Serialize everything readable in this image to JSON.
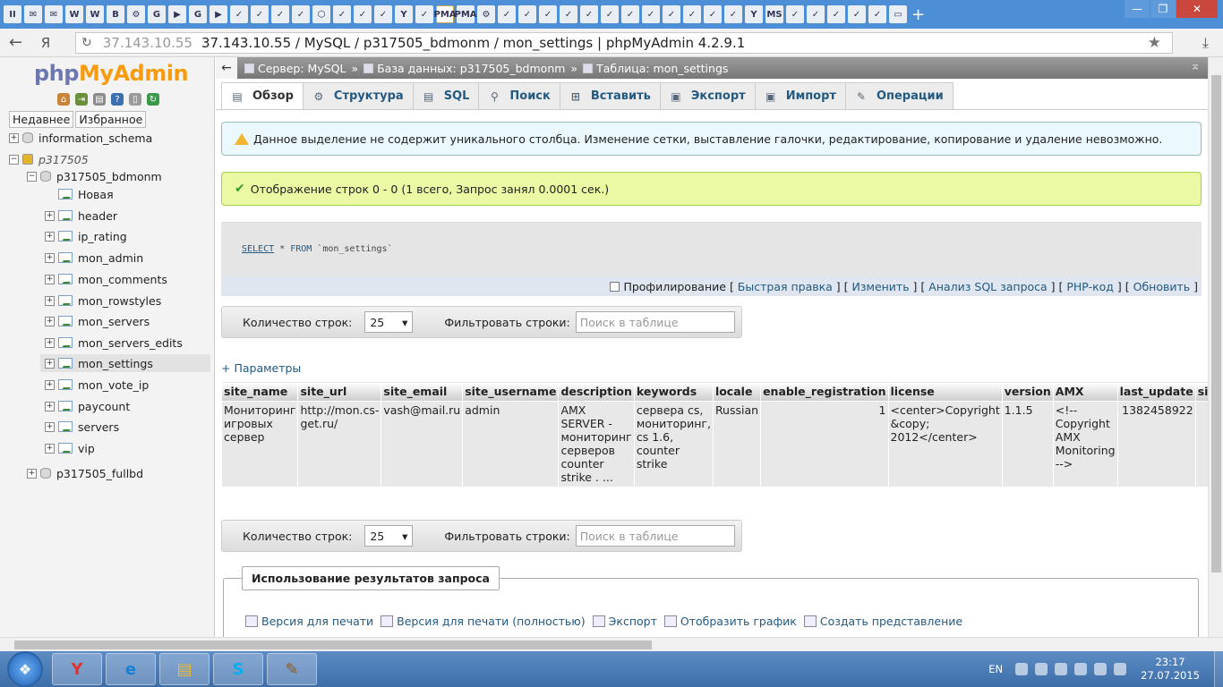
{
  "browser": {
    "tab_icons": [
      "II",
      "✉",
      "✉",
      "W",
      "W",
      "B",
      "⚙",
      "G",
      "▶",
      "G",
      "▶",
      "✓",
      "✓",
      "✓",
      "✓",
      "⬡",
      "✓",
      "✓",
      "✓",
      "Y",
      "✓",
      "PMA",
      "PMA",
      "⚙",
      "✓",
      "✓",
      "✓",
      "✓",
      "✓",
      "✓",
      "✓",
      "✓",
      "✓",
      "✓",
      "✓",
      "✓",
      "Y",
      "MS",
      "✓",
      "✓",
      "✓",
      "✓",
      "✓",
      "▭"
    ],
    "active_tab_index": 21,
    "new_tab_label": "+",
    "window_controls": {
      "minimize": "—",
      "restore": "❐",
      "close": "✕"
    },
    "back_label": "←",
    "yandex_label": "Я",
    "url_host": "37.143.10.55",
    "url_title": "37.143.10.55 / MySQL / p317505_bdmonm / mon_settings | phpMyAdmin 4.2.9.1",
    "star_label": "★",
    "download_label": "⤓",
    "reload_label": "↻"
  },
  "nav": {
    "logo_php": "php",
    "logo_myadmin": "MyAdmin",
    "recent_label": "Недавнее",
    "favorites_label": "Избранное",
    "tree": [
      {
        "label": "information_schema",
        "level": 0,
        "expander": "+",
        "type": "db",
        "selected": false,
        "italic": false
      },
      {
        "label": "p317505",
        "level": 0,
        "expander": "−",
        "type": "group",
        "selected": false,
        "italic": true
      },
      {
        "label": "p317505_bdmonm",
        "level": 1,
        "expander": "−",
        "type": "db",
        "selected": false,
        "italic": false
      },
      {
        "label": "Новая",
        "level": 2,
        "expander": "",
        "type": "new",
        "selected": false,
        "italic": false
      },
      {
        "label": "header",
        "level": 2,
        "expander": "+",
        "type": "table",
        "selected": false,
        "italic": false
      },
      {
        "label": "ip_rating",
        "level": 2,
        "expander": "+",
        "type": "table",
        "selected": false,
        "italic": false
      },
      {
        "label": "mon_admin",
        "level": 2,
        "expander": "+",
        "type": "table",
        "selected": false,
        "italic": false
      },
      {
        "label": "mon_comments",
        "level": 2,
        "expander": "+",
        "type": "table",
        "selected": false,
        "italic": false
      },
      {
        "label": "mon_rowstyles",
        "level": 2,
        "expander": "+",
        "type": "table",
        "selected": false,
        "italic": false
      },
      {
        "label": "mon_servers",
        "level": 2,
        "expander": "+",
        "type": "table",
        "selected": false,
        "italic": false
      },
      {
        "label": "mon_servers_edits",
        "level": 2,
        "expander": "+",
        "type": "table",
        "selected": false,
        "italic": false
      },
      {
        "label": "mon_settings",
        "level": 2,
        "expander": "+",
        "type": "table",
        "selected": true,
        "italic": false
      },
      {
        "label": "mon_vote_ip",
        "level": 2,
        "expander": "+",
        "type": "table",
        "selected": false,
        "italic": false
      },
      {
        "label": "paycount",
        "level": 2,
        "expander": "+",
        "type": "table",
        "selected": false,
        "italic": false
      },
      {
        "label": "servers",
        "level": 2,
        "expander": "+",
        "type": "table",
        "selected": false,
        "italic": false
      },
      {
        "label": "vip",
        "level": 2,
        "expander": "+",
        "type": "table",
        "selected": false,
        "italic": false
      },
      {
        "label": "p317505_fullbd",
        "level": 1,
        "expander": "+",
        "type": "db",
        "selected": false,
        "italic": false
      }
    ]
  },
  "breadcrumb": {
    "collapse_label": "←",
    "server": "Сервер: MySQL",
    "database": "База данных: p317505_bdmonm",
    "table": "Таблица: mon_settings",
    "separator": "»"
  },
  "tabs": [
    {
      "label": "Обзор",
      "icon": "▤",
      "active": true
    },
    {
      "label": "Структура",
      "icon": "⚙",
      "active": false
    },
    {
      "label": "SQL",
      "icon": "▤",
      "active": false
    },
    {
      "label": "Поиск",
      "icon": "⚲",
      "active": false
    },
    {
      "label": "Вставить",
      "icon": "⊞",
      "active": false
    },
    {
      "label": "Экспорт",
      "icon": "▣",
      "active": false
    },
    {
      "label": "Импорт",
      "icon": "▣",
      "active": false
    },
    {
      "label": "Операции",
      "icon": "✎",
      "active": false
    }
  ],
  "notice_text": "Данное выделение не содержит уникального столбца. Изменение сетки, выставление галочки, редактирование, копирование и удаление невозможно.",
  "success_text": "Отображение строк 0 - 0 (1 всего, Запрос занял 0.0001 сек.)",
  "sql": {
    "select": "SELECT",
    "middle": " * ",
    "from": "FROM",
    "table": " `mon_settings`"
  },
  "sql_links": {
    "profiling": "Профилирование",
    "quick_edit": "Быстрая правка",
    "edit": "Изменить",
    "analyze": "Анализ SQL запроса",
    "php": "PHP-код",
    "refresh": "Обновить"
  },
  "rows_bar": {
    "count_label": "Количество строк:",
    "count_value": "25",
    "filter_label": "Фильтровать строки:",
    "filter_placeholder": "Поиск в таблице"
  },
  "params_label": "+ Параметры",
  "table": {
    "columns": [
      "site_name",
      "site_url",
      "site_email",
      "site_username",
      "description",
      "keywords",
      "locale",
      "enable_registration",
      "license",
      "version",
      "AMX",
      "last_update",
      "site_c"
    ],
    "rows": [
      [
        "Мониторинг игровых сервер",
        "http://mon.cs-get.ru/",
        "vash@mail.ru",
        "admin",
        "AMX SERVER - мониторинг серверов counter strike . ...",
        "сервера cs, мониторинг, cs 1.6, counter strike",
        "Russian",
        "1",
        "<center>Copyright &copy; 2012</center>",
        "1.1.5",
        "<!-- Copyright AMX Monitoring -->",
        "1382458922",
        ""
      ]
    ]
  },
  "query_results": {
    "legend": "Использование результатов запроса",
    "links": [
      "Версия для печати",
      "Версия для печати (полностью)",
      "Экспорт",
      "Отобразить график",
      "Создать представление"
    ]
  },
  "taskbar": {
    "apps": [
      "Y",
      "e",
      "▤",
      "S",
      "✎"
    ],
    "lang": "EN",
    "time": "23:17",
    "date": "27.07.2015"
  },
  "colors": {
    "link": "#235a81",
    "logo_php": "#6c78af",
    "logo_myadmin": "#f89c0e",
    "notice_bg": "#ebf8fd",
    "success_bg": "#ebf8a4"
  }
}
